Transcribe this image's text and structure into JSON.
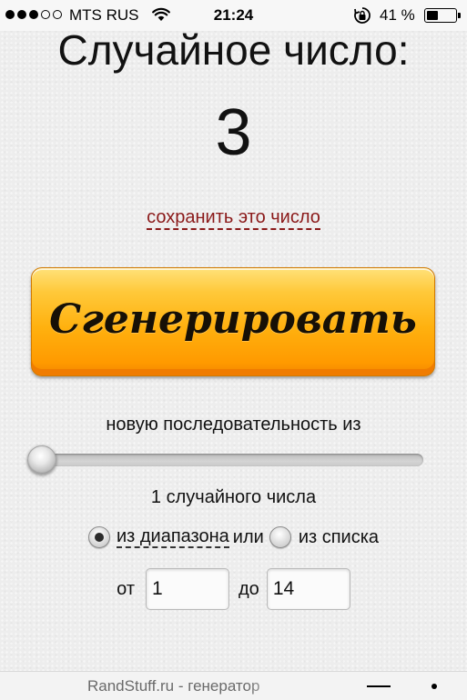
{
  "status_bar": {
    "carrier": "MTS RUS",
    "time": "21:24",
    "battery_percent": "41 %",
    "battery_level": 0.41,
    "signal_strength": 3,
    "signal_max": 5
  },
  "generator": {
    "title": "Случайное число:",
    "result": "3",
    "save_link": "сохранить это число",
    "generate_label": "Сгенерировать",
    "button_color": "#ffb10f"
  },
  "settings": {
    "sequence_label": "новую последовательность из",
    "slider_value": 1,
    "count_label": "1 случайного числа",
    "mode_range_label": "из диапазона",
    "or_word": "или",
    "mode_list_label": "из списка",
    "selected_mode": "range",
    "from_label": "от",
    "from_value": "1",
    "to_label": "до",
    "to_value": "14"
  },
  "bottom_bar": {
    "page_url": "RandStuff.ru - генератор"
  },
  "colors": {
    "link": "#8b1a1a",
    "background": "#ededed"
  }
}
